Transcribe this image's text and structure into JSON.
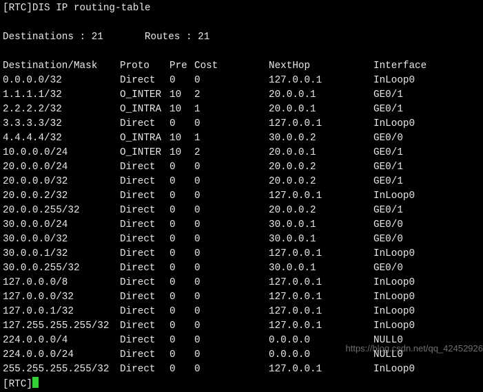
{
  "top_fragment": "[RTC]DIS IP routing-table",
  "blank": " ",
  "summary_line": "Destinations : 21       Routes : 21",
  "header": {
    "dest": "Destination/Mask",
    "proto": "Proto",
    "pre": "Pre",
    "cost": "Cost",
    "nexthop": "NextHop",
    "iface": "Interface"
  },
  "routes": [
    {
      "dest": "0.0.0.0/32",
      "proto": "Direct",
      "pre": "0",
      "cost": "0",
      "nexthop": "127.0.0.1",
      "iface": "InLoop0"
    },
    {
      "dest": "1.1.1.1/32",
      "proto": "O_INTER",
      "pre": "10",
      "cost": "2",
      "nexthop": "20.0.0.1",
      "iface": "GE0/1"
    },
    {
      "dest": "2.2.2.2/32",
      "proto": "O_INTRA",
      "pre": "10",
      "cost": "1",
      "nexthop": "20.0.0.1",
      "iface": "GE0/1"
    },
    {
      "dest": "3.3.3.3/32",
      "proto": "Direct",
      "pre": "0",
      "cost": "0",
      "nexthop": "127.0.0.1",
      "iface": "InLoop0"
    },
    {
      "dest": "4.4.4.4/32",
      "proto": "O_INTRA",
      "pre": "10",
      "cost": "1",
      "nexthop": "30.0.0.2",
      "iface": "GE0/0"
    },
    {
      "dest": "10.0.0.0/24",
      "proto": "O_INTER",
      "pre": "10",
      "cost": "2",
      "nexthop": "20.0.0.1",
      "iface": "GE0/1"
    },
    {
      "dest": "20.0.0.0/24",
      "proto": "Direct",
      "pre": "0",
      "cost": "0",
      "nexthop": "20.0.0.2",
      "iface": "GE0/1"
    },
    {
      "dest": "20.0.0.0/32",
      "proto": "Direct",
      "pre": "0",
      "cost": "0",
      "nexthop": "20.0.0.2",
      "iface": "GE0/1"
    },
    {
      "dest": "20.0.0.2/32",
      "proto": "Direct",
      "pre": "0",
      "cost": "0",
      "nexthop": "127.0.0.1",
      "iface": "InLoop0"
    },
    {
      "dest": "20.0.0.255/32",
      "proto": "Direct",
      "pre": "0",
      "cost": "0",
      "nexthop": "20.0.0.2",
      "iface": "GE0/1"
    },
    {
      "dest": "30.0.0.0/24",
      "proto": "Direct",
      "pre": "0",
      "cost": "0",
      "nexthop": "30.0.0.1",
      "iface": "GE0/0"
    },
    {
      "dest": "30.0.0.0/32",
      "proto": "Direct",
      "pre": "0",
      "cost": "0",
      "nexthop": "30.0.0.1",
      "iface": "GE0/0"
    },
    {
      "dest": "30.0.0.1/32",
      "proto": "Direct",
      "pre": "0",
      "cost": "0",
      "nexthop": "127.0.0.1",
      "iface": "InLoop0"
    },
    {
      "dest": "30.0.0.255/32",
      "proto": "Direct",
      "pre": "0",
      "cost": "0",
      "nexthop": "30.0.0.1",
      "iface": "GE0/0"
    },
    {
      "dest": "127.0.0.0/8",
      "proto": "Direct",
      "pre": "0",
      "cost": "0",
      "nexthop": "127.0.0.1",
      "iface": "InLoop0"
    },
    {
      "dest": "127.0.0.0/32",
      "proto": "Direct",
      "pre": "0",
      "cost": "0",
      "nexthop": "127.0.0.1",
      "iface": "InLoop0"
    },
    {
      "dest": "127.0.0.1/32",
      "proto": "Direct",
      "pre": "0",
      "cost": "0",
      "nexthop": "127.0.0.1",
      "iface": "InLoop0"
    },
    {
      "dest": "127.255.255.255/32",
      "proto": "Direct",
      "pre": "0",
      "cost": "0",
      "nexthop": "127.0.0.1",
      "iface": "InLoop0"
    },
    {
      "dest": "224.0.0.0/4",
      "proto": "Direct",
      "pre": "0",
      "cost": "0",
      "nexthop": "0.0.0.0",
      "iface": "NULL0"
    },
    {
      "dest": "224.0.0.0/24",
      "proto": "Direct",
      "pre": "0",
      "cost": "0",
      "nexthop": "0.0.0.0",
      "iface": "NULL0"
    },
    {
      "dest": "255.255.255.255/32",
      "proto": "Direct",
      "pre": "0",
      "cost": "0",
      "nexthop": "127.0.0.1",
      "iface": "InLoop0"
    }
  ],
  "prompt": "[RTC]",
  "watermark": "https://blog.csdn.net/qq_42452926"
}
